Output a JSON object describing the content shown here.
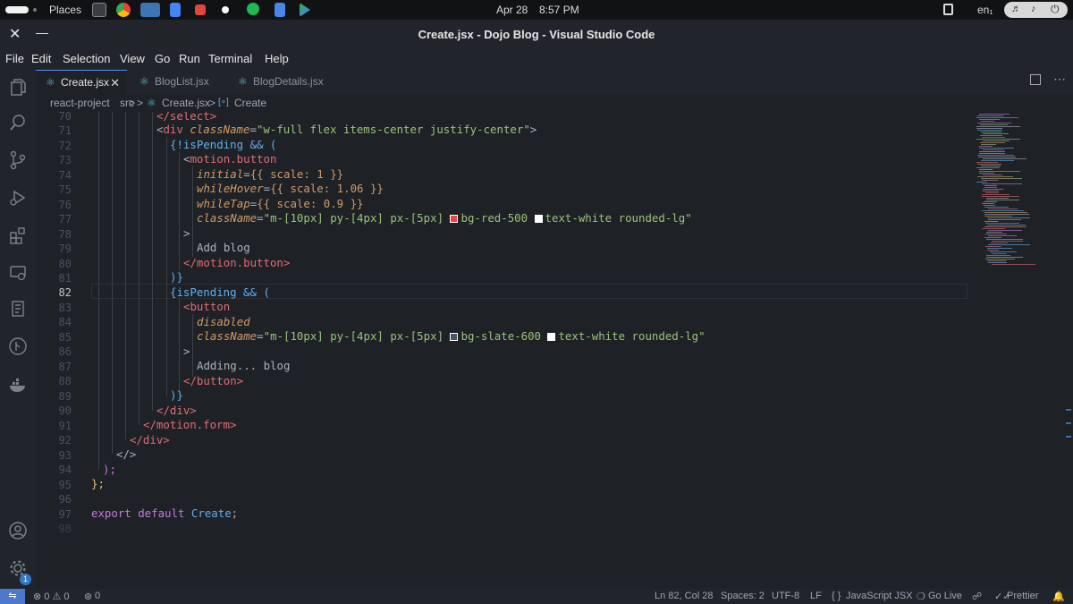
{
  "system_bar": {
    "places": "Places",
    "date": "Apr 28",
    "time": "8:57 PM",
    "language": "en₁",
    "tray_icons": [
      "files-icon",
      "chrome-icon",
      "vscode-icon",
      "docs-icon",
      "app-icon",
      "circle-app-icon",
      "spotify-icon",
      "notes-icon",
      "play-icon"
    ]
  },
  "window": {
    "title": "Create.jsx - Dojo Blog - Visual Studio Code",
    "close": "✕",
    "minimize": "—"
  },
  "menu": [
    "File",
    "Edit",
    "Selection",
    "View",
    "Go",
    "Run",
    "Terminal",
    "Help"
  ],
  "activity_bar": {
    "items": [
      "explorer-icon",
      "search-icon",
      "source-control-icon",
      "run-debug-icon",
      "extensions-icon",
      "remote-explorer-icon",
      "testing-icon",
      "git-graph-icon",
      "docker-icon"
    ],
    "accounts": "accounts-icon",
    "manage": "gear-icon",
    "manage_badge": "1"
  },
  "tabs": [
    {
      "label": "Create.jsx",
      "active": true,
      "close": "✕"
    },
    {
      "label": "BlogList.jsx",
      "active": false
    },
    {
      "label": "BlogDetails.jsx",
      "active": false
    }
  ],
  "breadcrumbs": {
    "parts": [
      "react-project",
      ">",
      "src",
      ">",
      "Create.jsx",
      ">",
      "Create"
    ],
    "symbol_icon": "[∘]"
  },
  "editor": {
    "current_line": "82",
    "line_numbers": [
      "70",
      "71",
      "72",
      "73",
      "74",
      "75",
      "76",
      "77",
      "78",
      "79",
      "80",
      "81",
      "82",
      "83",
      "84",
      "85",
      "86",
      "87",
      "88",
      "89",
      "90",
      "91",
      "92",
      "93",
      "94",
      "95",
      "96",
      "97",
      "98"
    ],
    "code": {
      "l70": "</select>",
      "l71_open": "<",
      "l71_tag": "div",
      "l71_attr": "className",
      "l71_val": "\"w-full flex items-center justify-center\"",
      "l71_close": ">",
      "l72": "{!isPending && (",
      "l73_tag": "motion.button",
      "l74_attr": "initial",
      "l74_val": "{{ scale: 1 }}",
      "l75_attr": "whileHover",
      "l75_val": "{{ scale: 1.06 }}",
      "l76_attr": "whileTap",
      "l76_val": "{{ scale: 0.9 }}",
      "l77_attr": "className",
      "l77_val_a": "\"m-[10px] py-[4px] px-[5px] ",
      "l77_val_b": "bg-red-500 ",
      "l77_val_c": "text-white rounded-lg\"",
      "l78": ">",
      "l79": "Add blog",
      "l80": "</motion.button>",
      "l81": ")}",
      "l82": "{isPending && (",
      "l83": "<button",
      "l84": "disabled",
      "l85_attr": "className",
      "l85_val_a": "\"m-[10px] py-[4px] px-[5px] ",
      "l85_val_b": "bg-slate-600 ",
      "l85_val_c": "text-white rounded-lg\"",
      "l86": ">",
      "l87": "Adding... blog",
      "l88": "</button>",
      "l89": ")}",
      "l90": "</div>",
      "l91": "</motion.form>",
      "l92": "</div>",
      "l93": "</>",
      "l94": ");",
      "l95": "};",
      "l96": "",
      "l97_kw": "export default ",
      "l97_name": "Create",
      "l97_end": ";"
    },
    "swatches": {
      "red": "#ef4444",
      "slate": "#475569",
      "white": "#ffffff"
    }
  },
  "status_bar": {
    "remote_icon": "remote-icon",
    "problems": "⊗ 0 ⚠ 0",
    "ports": "0",
    "position": "Ln 82, Col 28",
    "spaces": "Spaces: 2",
    "encoding": "UTF-8",
    "eol": "LF",
    "language": "JavaScript JSX",
    "go_live": "Go Live",
    "prettier": "Prettier"
  },
  "colors": {
    "accent": "#528bff",
    "background": "#1e2227",
    "panel": "#21252b",
    "status_remote": "#4d78cc"
  }
}
